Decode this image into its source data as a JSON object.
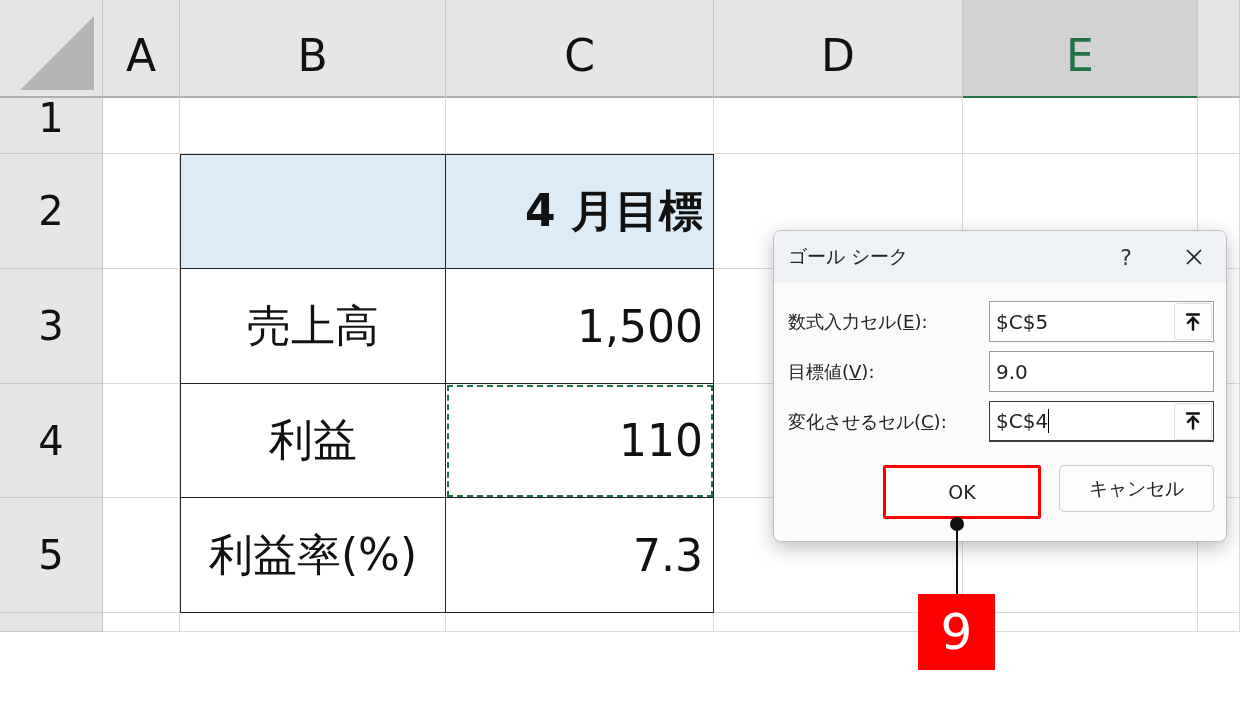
{
  "sheet": {
    "columns": [
      {
        "label": "A",
        "selected": false
      },
      {
        "label": "B",
        "selected": false
      },
      {
        "label": "C",
        "selected": false
      },
      {
        "label": "D",
        "selected": false
      },
      {
        "label": "E",
        "selected": true
      }
    ],
    "rows": [
      {
        "label": "1",
        "cells": [
          {
            "kind": "empty"
          },
          {
            "kind": "empty"
          },
          {
            "kind": "empty"
          },
          {
            "kind": "empty"
          },
          {
            "kind": "empty"
          }
        ]
      },
      {
        "label": "2",
        "cells": [
          {
            "kind": "empty"
          },
          {
            "kind": "header",
            "marquee": false
          },
          {
            "kind": "header",
            "text": "4 月目標",
            "marquee": false
          },
          {
            "kind": "empty"
          },
          {
            "kind": "empty"
          }
        ]
      },
      {
        "label": "3",
        "cells": [
          {
            "kind": "empty"
          },
          {
            "kind": "label",
            "text": "売上高",
            "marquee": false
          },
          {
            "kind": "number",
            "text": "1,500",
            "marquee": false
          },
          {
            "kind": "empty"
          },
          {
            "kind": "empty"
          }
        ]
      },
      {
        "label": "4",
        "cells": [
          {
            "kind": "empty"
          },
          {
            "kind": "label",
            "text": "利益",
            "marquee": false
          },
          {
            "kind": "number",
            "text": "110",
            "marquee": true
          },
          {
            "kind": "empty"
          },
          {
            "kind": "empty"
          }
        ]
      },
      {
        "label": "5",
        "cells": [
          {
            "kind": "empty"
          },
          {
            "kind": "label",
            "text": "利益率(%)",
            "marquee": false
          },
          {
            "kind": "number",
            "text": "7.3",
            "marquee": false
          },
          {
            "kind": "empty"
          },
          {
            "kind": "empty"
          }
        ]
      }
    ]
  },
  "dialog": {
    "title": "ゴール シーク",
    "help": "?",
    "fields": [
      {
        "label_before": "数式入力セル(",
        "access_key": "E",
        "label_after": "):",
        "value": "$C$5",
        "kind": "reference",
        "focused": false
      },
      {
        "label_before": "目標値(",
        "access_key": "V",
        "label_after": "):",
        "value": "9.0",
        "kind": "plain",
        "focused": false
      },
      {
        "label_before": "変化させるセル(",
        "access_key": "C",
        "label_after": "):",
        "value": "$C$4",
        "kind": "reference",
        "focused": true
      }
    ],
    "buttons": [
      {
        "label": "OK",
        "highlighted": true
      },
      {
        "label": "キャンセル",
        "highlighted": false
      }
    ]
  },
  "annotation": {
    "step": "9"
  }
}
